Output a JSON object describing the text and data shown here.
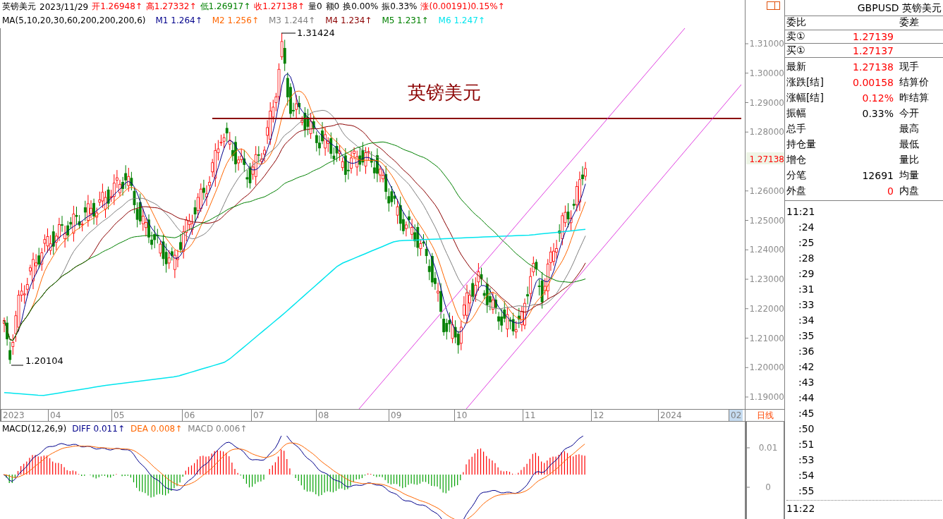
{
  "header": {
    "name": "英镑美元",
    "date": "2023/11/29",
    "quotes": [
      {
        "text": "开1.26948↑",
        "color": "#ff0000"
      },
      {
        "text": "高1.27332↑",
        "color": "#ff0000"
      },
      {
        "text": "低1.26917↑",
        "color": "#008000"
      },
      {
        "text": "收1.27138↑",
        "color": "#ff0000"
      },
      {
        "text": "量0",
        "color": "#000000"
      },
      {
        "text": "额0",
        "color": "#000000"
      },
      {
        "text": "换0.00%",
        "color": "#000000"
      },
      {
        "text": "振0.33%",
        "color": "#000000"
      },
      {
        "text": "涨(0.00191)0.15%↑",
        "color": "#ff0000"
      }
    ]
  },
  "ma_legend": {
    "title": "MA(5,10,20,30,60,200,200,200,6)",
    "items": [
      {
        "text": "M1 1.264↑",
        "color": "#00008b"
      },
      {
        "text": "M2 1.256↑",
        "color": "#ff6600"
      },
      {
        "text": "M3 1.244↑",
        "color": "#808080"
      },
      {
        "text": "M4 1.234↑",
        "color": "#8b0000"
      },
      {
        "text": "M5 1.231↑",
        "color": "#008000"
      },
      {
        "text": "M6 1.247↑",
        "color": "#00e5ee"
      }
    ]
  },
  "main_chart": {
    "title": "英镑美元",
    "high_label": "1.31424",
    "low_label": "1.20104",
    "price_ticks": [
      "1.31000",
      "1.30000",
      "1.29000",
      "1.28000",
      "1.26000",
      "1.25000",
      "1.24000",
      "1.23000",
      "1.22000",
      "1.21000",
      "1.20000",
      "1.19000"
    ],
    "current_price": "1.27138",
    "months": [
      {
        "label": "2023",
        "selected": false
      },
      {
        "label": "04",
        "selected": false
      },
      {
        "label": "05",
        "selected": false
      },
      {
        "label": "06",
        "selected": false
      },
      {
        "label": "07",
        "selected": false
      },
      {
        "label": "08",
        "selected": false
      },
      {
        "label": "09",
        "selected": false
      },
      {
        "label": "10",
        "selected": false
      },
      {
        "label": "11",
        "selected": false
      },
      {
        "label": "12",
        "selected": false
      },
      {
        "label": "2024",
        "selected": false
      },
      {
        "label": "02",
        "selected": true
      }
    ],
    "period": "日线"
  },
  "macd": {
    "legend": [
      {
        "text": "MACD(12,26,9)",
        "color": "#000000"
      },
      {
        "text": "DIFF 0.011↑",
        "color": "#00008b"
      },
      {
        "text": "DEA 0.008↑",
        "color": "#ff6600"
      },
      {
        "text": "MACD 0.006↑",
        "color": "#808080"
      }
    ],
    "ticks": [
      "0.01",
      "0"
    ]
  },
  "quote_panel": {
    "title": "GBPUSD 英镑美元",
    "head": [
      "委比",
      "委差"
    ],
    "orders": [
      {
        "label": "卖①",
        "value": "1.27139",
        "color": "#ff0000"
      },
      {
        "label": "买①",
        "value": "1.27137",
        "color": "#ff0000"
      }
    ],
    "rows": [
      {
        "label": "最新",
        "value": "1.27138",
        "color": "#ff0000",
        "label2": "现手"
      },
      {
        "label": "涨跌[结]",
        "value": "0.00158",
        "color": "#ff0000",
        "label2": "结算价"
      },
      {
        "label": "涨幅[结]",
        "value": "0.12%",
        "color": "#ff0000",
        "label2": "昨结算"
      },
      {
        "label": "振幅",
        "value": "0.33%",
        "color": "#000000",
        "label2": "今开"
      },
      {
        "label": "总手",
        "label2": "最高"
      },
      {
        "label": "持仓量",
        "label2": "最低"
      },
      {
        "label": "增仓",
        "label2": "量比"
      },
      {
        "label": "分笔",
        "value": "12691",
        "color": "#000000",
        "label2": "均量"
      },
      {
        "label": "外盘",
        "value": "0",
        "color": "#ff0000",
        "label2": "内盘"
      }
    ],
    "times": [
      "11:21",
      ":24",
      ":25",
      ":28",
      ":29",
      ":31",
      ":33",
      ":34",
      ":35",
      ":36",
      ":42",
      ":43",
      ":44",
      ":45",
      ":50",
      ":51",
      ":53",
      ":54",
      ":55"
    ],
    "next_time": "11:22"
  }
}
